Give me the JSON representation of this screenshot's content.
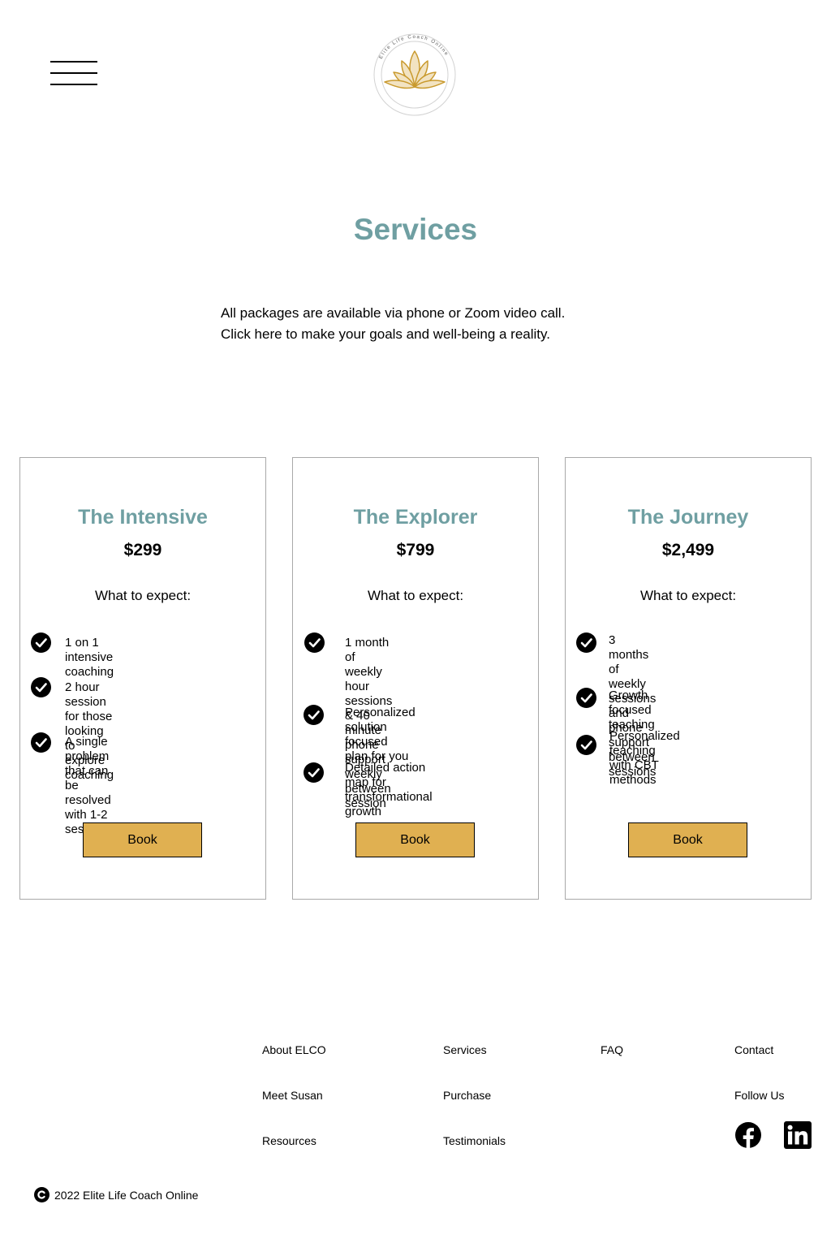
{
  "header": {
    "menu_icon": "hamburger-icon",
    "logo": {
      "icon": "lotus-logo",
      "ring_text": "Elite Life Coach Online",
      "color": "#c99a2e"
    }
  },
  "page": {
    "title": "Services",
    "intro_line1": "All packages are available via phone or Zoom video call.",
    "intro_line2": "Click here to make your goals and well-being a reality."
  },
  "colors": {
    "accent": "#6f9fa2",
    "button": "#e0b051",
    "border": "#a9a9a9"
  },
  "packages": [
    {
      "title": "The Intensive",
      "price": "$299",
      "expect_label": "What to expect:",
      "features": [
        {
          "line1": "1 on 1 intensive coaching",
          "line2": ""
        },
        {
          "line1": "2 hour session for those looking",
          "line2": "to explore coaching"
        },
        {
          "line1": "A single problem that can be",
          "line2": "resolved with 1-2 sessions"
        }
      ],
      "button_label": "Book"
    },
    {
      "title": "The Explorer",
      "price": "$799",
      "expect_label": "What to expect:",
      "features": [
        {
          "line1": "1 month of weekly hour sessions",
          "line2": "& 40 minute phone support",
          "line3": "weekly between session"
        },
        {
          "line1": "Personalized solution focused",
          "line2": "plan for you"
        },
        {
          "line1": "Detailed action map for",
          "line2": "transformational growth"
        }
      ],
      "button_label": "Book"
    },
    {
      "title": "The Journey",
      "price": "$2,499",
      "expect_label": "What to expect:",
      "features": [
        {
          "line1": "3 months of weekly sessions and",
          "line2": "phone support between sessions"
        },
        {
          "line1": "Growth focused teaching",
          "line2": ""
        },
        {
          "line1": "Personalized teaching with CBT",
          "line2": "methods"
        }
      ],
      "button_label": "Book"
    }
  ],
  "footer": {
    "links": {
      "about": "About ELCO",
      "meet": "Meet Susan",
      "resources": "Resources",
      "services": "Services",
      "purchase": "Purchase",
      "testimonials": "Testimonials",
      "faq": "FAQ",
      "contact": "Contact"
    },
    "follow_label": "Follow Us",
    "social_icons": [
      "facebook-icon",
      "linkedin-icon"
    ],
    "copyright": "2022 Elite Life Coach Online"
  }
}
